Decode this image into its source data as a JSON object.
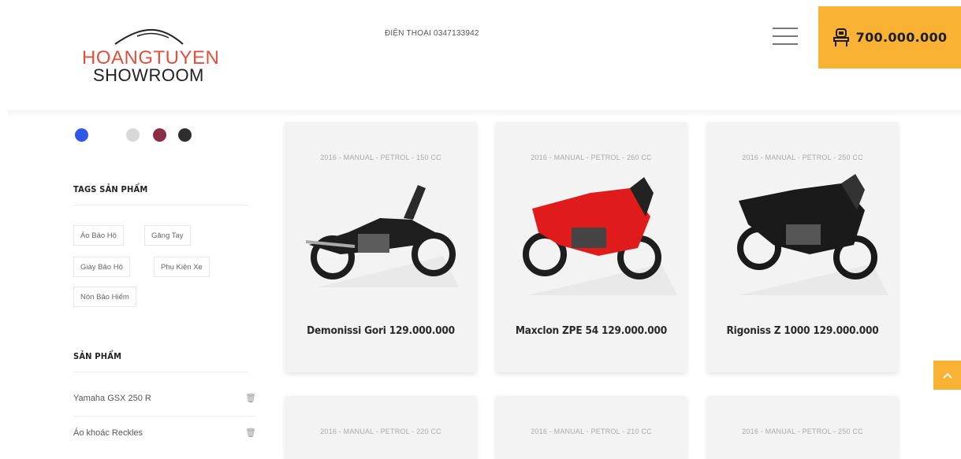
{
  "header": {
    "logo_line1": "HOANGTUYEN",
    "logo_line2": "SHOWROOM",
    "phone": "ĐIỆN THOẠI 0347133942",
    "cart_amount": "700.000.000"
  },
  "sidebar": {
    "colors": [
      "#3057e8",
      "#d8d8d8",
      "#8b2c45",
      "#2e2e2e"
    ],
    "tags_title": "TAGS SẢN PHẨM",
    "tags": [
      "Áo Bảo Hộ",
      "Găng Tay",
      "Giày Bảo Hộ",
      "Phụ Kiện Xe",
      "Nón Bảo Hiểm"
    ],
    "products_title": "SẢN PHẨM",
    "products": [
      "Yamaha GSX 250 R",
      "Áo khoác Reckles"
    ]
  },
  "cards": [
    {
      "specs": "2016 - MANUAL - PETROL - 150 CC",
      "title": "Demonissi Gori  129.000.000",
      "bike_color": "#1e1e1e"
    },
    {
      "specs": "2016 - MANUAL - PETROL - 260 CC",
      "title": "Maxclon ZPE 54 129.000.000",
      "bike_color": "#e01b1b"
    },
    {
      "specs": "2016 - MANUAL - PETROL - 250 CC",
      "title": "Rigoniss Z 1000 129.000.000",
      "bike_color": "#1a1a1a"
    },
    {
      "specs": "2016 - MANUAL - PETROL - 220 CC",
      "title": "",
      "bike_color": ""
    },
    {
      "specs": "2016 - MANUAL - PETROL - 210 CC",
      "title": "",
      "bike_color": ""
    },
    {
      "specs": "2016 - MANUAL - PETROL - 250 CC",
      "title": "",
      "bike_color": ""
    }
  ],
  "icons": {
    "cart": "cart-icon",
    "menu": "hamburger-icon",
    "trash": "trash-icon",
    "to_top": "chevron-up-icon"
  },
  "accent_color": "#f9b233"
}
